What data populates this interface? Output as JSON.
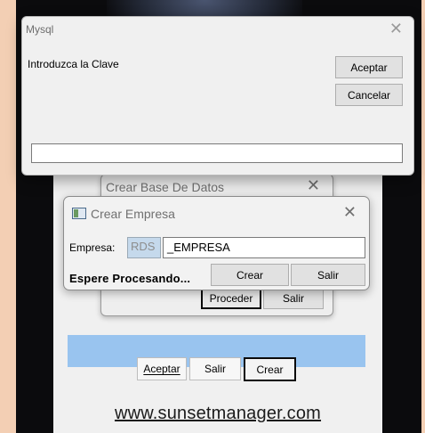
{
  "mysql_dialog": {
    "title": "Mysql",
    "close_glyph": "✕",
    "prompt": "Introduzca la Clave",
    "accept_label": "Aceptar",
    "cancel_label": "Cancelar",
    "password_value": ""
  },
  "db_window": {
    "title": "Crear Base De Datos",
    "close_glyph": "✕",
    "proceed_label": "Proceder",
    "exit_label": "Salir"
  },
  "empresa_window": {
    "title": "Crear Empresa",
    "close_glyph": "✕",
    "empresa_label": "Empresa:",
    "prefix": "RDS",
    "empresa_value": "_EMPRESA",
    "status": "Espere Procesando...",
    "create_label": "Crear",
    "exit_label": "Salir"
  },
  "main_window": {
    "accept_label": "Aceptar",
    "exit_label": "Salir",
    "create_label": "Crear",
    "website": "www.sunsetmanager.com"
  }
}
